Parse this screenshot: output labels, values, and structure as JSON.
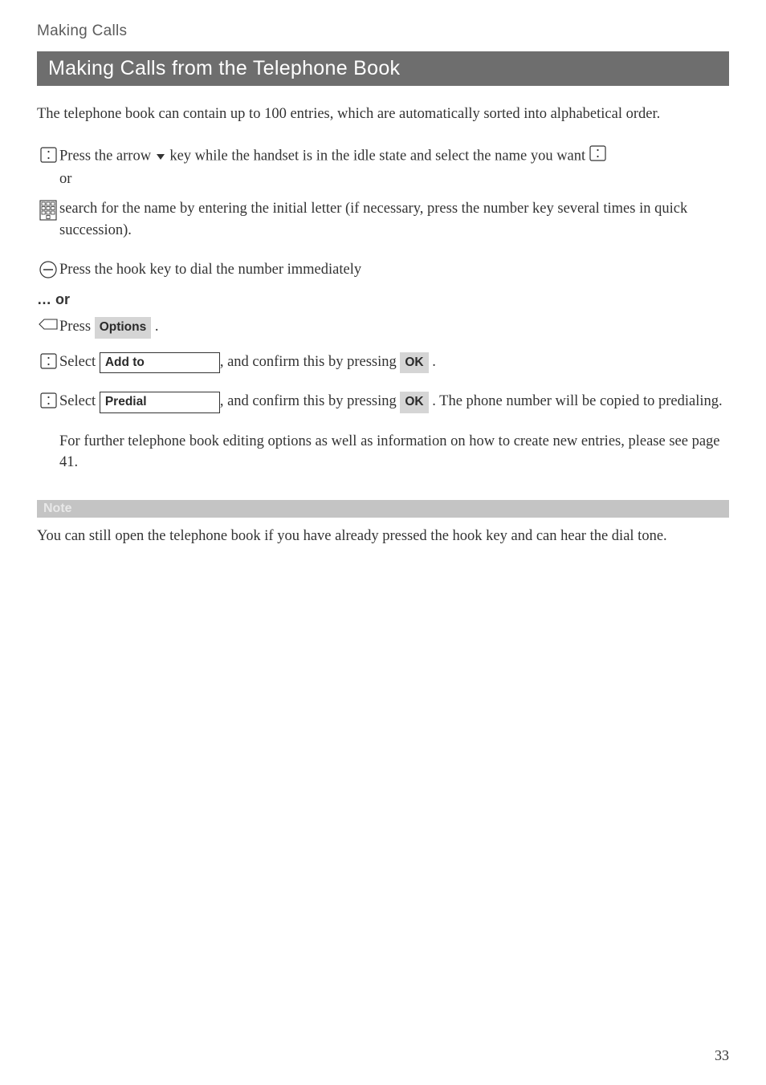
{
  "top_heading": "Making Calls",
  "banner": "Making Calls from the Telephone Book",
  "intro": "The telephone book can contain up to 100 entries, which are automatically sorted into alphabetical order.",
  "step1_pre": "Press the arrow ",
  "step1_post": " key while the handset is in the idle state and select the name you want ",
  "step1_or": "or",
  "step2": "search for the name by entering the initial letter (if necessary, press the number key several times in quick succession).",
  "step3": "Press the hook key to dial the number immediately",
  "or_label": "… or",
  "press_word": "Press",
  "options_chip": "Options",
  "dot": ".",
  "select_word": "Select",
  "addto_box": "Add to",
  "confirm_text": ", and confirm this by pressing",
  "ok_chip": "OK",
  "dot2": ".",
  "predial_box": "Predial",
  "predial_tail": ". The phone number will be copied to predialing.",
  "further": "For further telephone book editing options as well as information on how to create new entries, please see page 41.",
  "note_label": "Note",
  "note_body": "You can still open the telephone book if you have already pressed the hook key and can hear the dial tone.",
  "page_number": "33"
}
